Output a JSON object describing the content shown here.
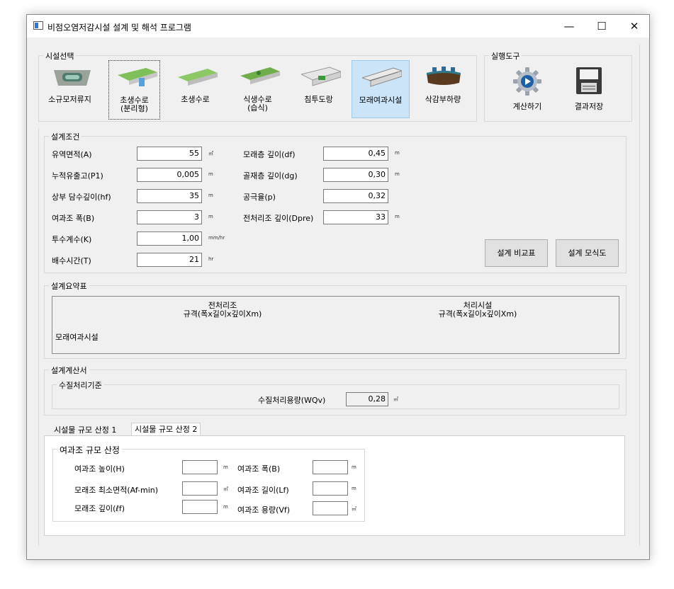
{
  "window": {
    "title": "비점오염저감시설 설계 및 해석 프로그램",
    "min": "—",
    "max": "☐",
    "close": "✕"
  },
  "facility_group": {
    "label": "시설선택",
    "items": [
      {
        "label": "소규모저류지",
        "icon": "small-retention-pond-icon"
      },
      {
        "label": "초생수로\n(분리형)",
        "icon": "grassed-swale-separated-icon"
      },
      {
        "label": "초생수로",
        "icon": "grassed-swale-icon"
      },
      {
        "label": "식생수로\n(습식)",
        "icon": "vegetated-swale-wet-icon"
      },
      {
        "label": "침투도랑",
        "icon": "infiltration-trench-icon"
      },
      {
        "label": "모래여과시설",
        "icon": "sand-filter-icon"
      },
      {
        "label": "삭감부하량",
        "icon": "load-reduction-icon"
      }
    ]
  },
  "tools_group": {
    "label": "실행도구",
    "calc": "계산하기",
    "save": "결과저장"
  },
  "design_conditions": {
    "label": "설계조건",
    "left": [
      {
        "label": "유역면적(A)",
        "value": "55",
        "unit": "㎡"
      },
      {
        "label": "누적유출고(P1)",
        "value": "0,005",
        "unit": "m"
      },
      {
        "label": "상부 담수깊이(hf)",
        "value": "35",
        "unit": "m"
      },
      {
        "label": "여과조 폭(B)",
        "value": "3",
        "unit": "m"
      },
      {
        "label": "투수계수(K)",
        "value": "1,00",
        "unit": "mm/hr"
      },
      {
        "label": "배수시간(T)",
        "value": "21",
        "unit": "hr"
      }
    ],
    "right": [
      {
        "label": "모래층 깊이(df)",
        "value": "0,45",
        "unit": "m"
      },
      {
        "label": "골재층 깊이(dg)",
        "value": "0,30",
        "unit": "m"
      },
      {
        "label": "공극율(p)",
        "value": "0,32",
        "unit": ""
      },
      {
        "label": "전처리조 깊이(Dpre)",
        "value": "33",
        "unit": "m"
      }
    ],
    "compare_button": "설계 비교표",
    "diagram_button": "설계 모식도"
  },
  "summary": {
    "label": "설계요약표",
    "col1_title": "전처리조",
    "col1_sub": "규격(폭x길이x깊이Xm)",
    "col2_title": "처리시설",
    "col2_sub": "규격(폭x길이x깊이Xm)",
    "row_label": "모래여과시설"
  },
  "calc_sheet": {
    "label": "설계계산서",
    "wq_label": "수질처리기준",
    "wqv_label": "수질처리용량(WQv)",
    "wqv_value": "0,28",
    "wqv_unit": "㎥"
  },
  "tabs": [
    {
      "label": "시설물 규모 산정 1"
    },
    {
      "label": "시설물 규모 산정 2"
    }
  ],
  "filter_sizing": {
    "label": "여과조 규모 산정",
    "left": [
      {
        "label": "여과조 높이(H)",
        "value": "",
        "unit": "m"
      },
      {
        "label": "모래조 최소면적(Af-min)",
        "value": "",
        "unit": "㎡"
      },
      {
        "label": "모래조 깊이(ℓf)",
        "value": "",
        "unit": "m"
      }
    ],
    "right": [
      {
        "label": "여과조 폭(B)",
        "value": "",
        "unit": "m"
      },
      {
        "label": "여과조 길이(Lf)",
        "value": "",
        "unit": "m"
      },
      {
        "label": "여과조 용량(Vf)",
        "value": "",
        "unit": "㎥"
      }
    ]
  }
}
